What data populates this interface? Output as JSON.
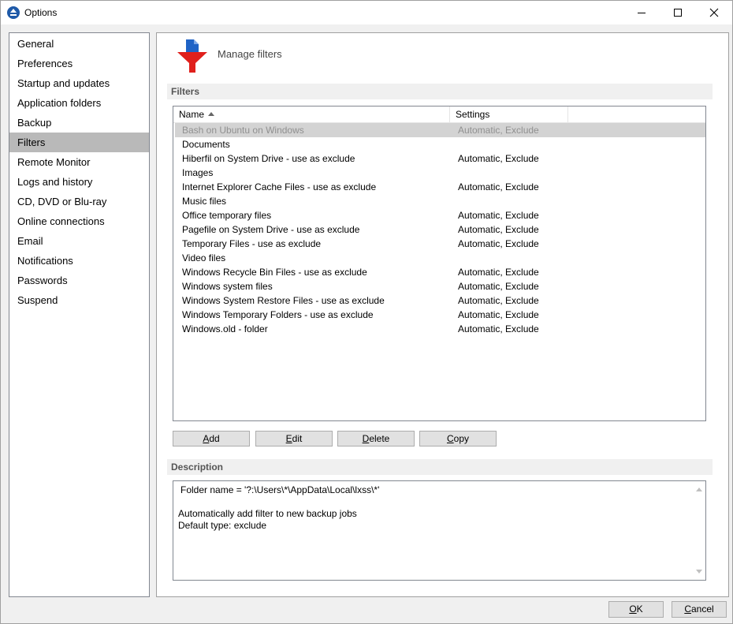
{
  "window": {
    "title": "Options"
  },
  "sidebar": {
    "items": [
      {
        "label": "General"
      },
      {
        "label": "Preferences"
      },
      {
        "label": "Startup and updates"
      },
      {
        "label": "Application folders"
      },
      {
        "label": "Backup"
      },
      {
        "label": "Filters",
        "selected": true
      },
      {
        "label": "Remote Monitor"
      },
      {
        "label": "Logs and history"
      },
      {
        "label": "CD, DVD or Blu-ray"
      },
      {
        "label": "Online connections"
      },
      {
        "label": "Email"
      },
      {
        "label": "Notifications"
      },
      {
        "label": "Passwords"
      },
      {
        "label": "Suspend"
      }
    ]
  },
  "main": {
    "header_title": "Manage filters",
    "filters_section": "Filters",
    "columns": {
      "name": "Name",
      "settings": "Settings"
    },
    "rows": [
      {
        "name": "Bash on Ubuntu on Windows",
        "settings": "Automatic, Exclude",
        "selected": true
      },
      {
        "name": "Documents",
        "settings": ""
      },
      {
        "name": "Hiberfil on System Drive - use as exclude",
        "settings": "Automatic, Exclude"
      },
      {
        "name": "Images",
        "settings": ""
      },
      {
        "name": "Internet Explorer Cache Files - use as exclude",
        "settings": "Automatic, Exclude"
      },
      {
        "name": "Music files",
        "settings": ""
      },
      {
        "name": "Office temporary files",
        "settings": "Automatic, Exclude"
      },
      {
        "name": "Pagefile on System Drive - use as exclude",
        "settings": "Automatic, Exclude"
      },
      {
        "name": "Temporary Files - use as exclude",
        "settings": "Automatic, Exclude"
      },
      {
        "name": "Video files",
        "settings": ""
      },
      {
        "name": "Windows Recycle Bin Files - use as exclude",
        "settings": "Automatic, Exclude"
      },
      {
        "name": "Windows system files",
        "settings": "Automatic, Exclude"
      },
      {
        "name": "Windows System Restore Files - use as exclude",
        "settings": "Automatic, Exclude"
      },
      {
        "name": "Windows Temporary Folders - use as exclude",
        "settings": "Automatic, Exclude"
      },
      {
        "name": "Windows.old - folder",
        "settings": "Automatic, Exclude"
      }
    ],
    "buttons": {
      "add_key": "A",
      "add_rest": "dd",
      "edit_key": "E",
      "edit_rest": "dit",
      "delete_key": "D",
      "delete_rest": "elete",
      "copy_key": "C",
      "copy_rest": "opy"
    },
    "description_section": "Description",
    "description_lines": [
      "Folder name = '?:\\Users\\*\\AppData\\Local\\lxss\\*'",
      "",
      "Automatically add filter to new backup jobs",
      "Default type: exclude"
    ]
  },
  "footer": {
    "ok_key": "O",
    "ok_rest": "K",
    "cancel_key": "C",
    "cancel_rest": "ancel"
  },
  "colors": {
    "selected_sidebar": "#b9b9b9",
    "selected_row": "#d3d3d3",
    "filter_icon_red": "#e0201c",
    "filter_icon_blue": "#1f63c6"
  }
}
